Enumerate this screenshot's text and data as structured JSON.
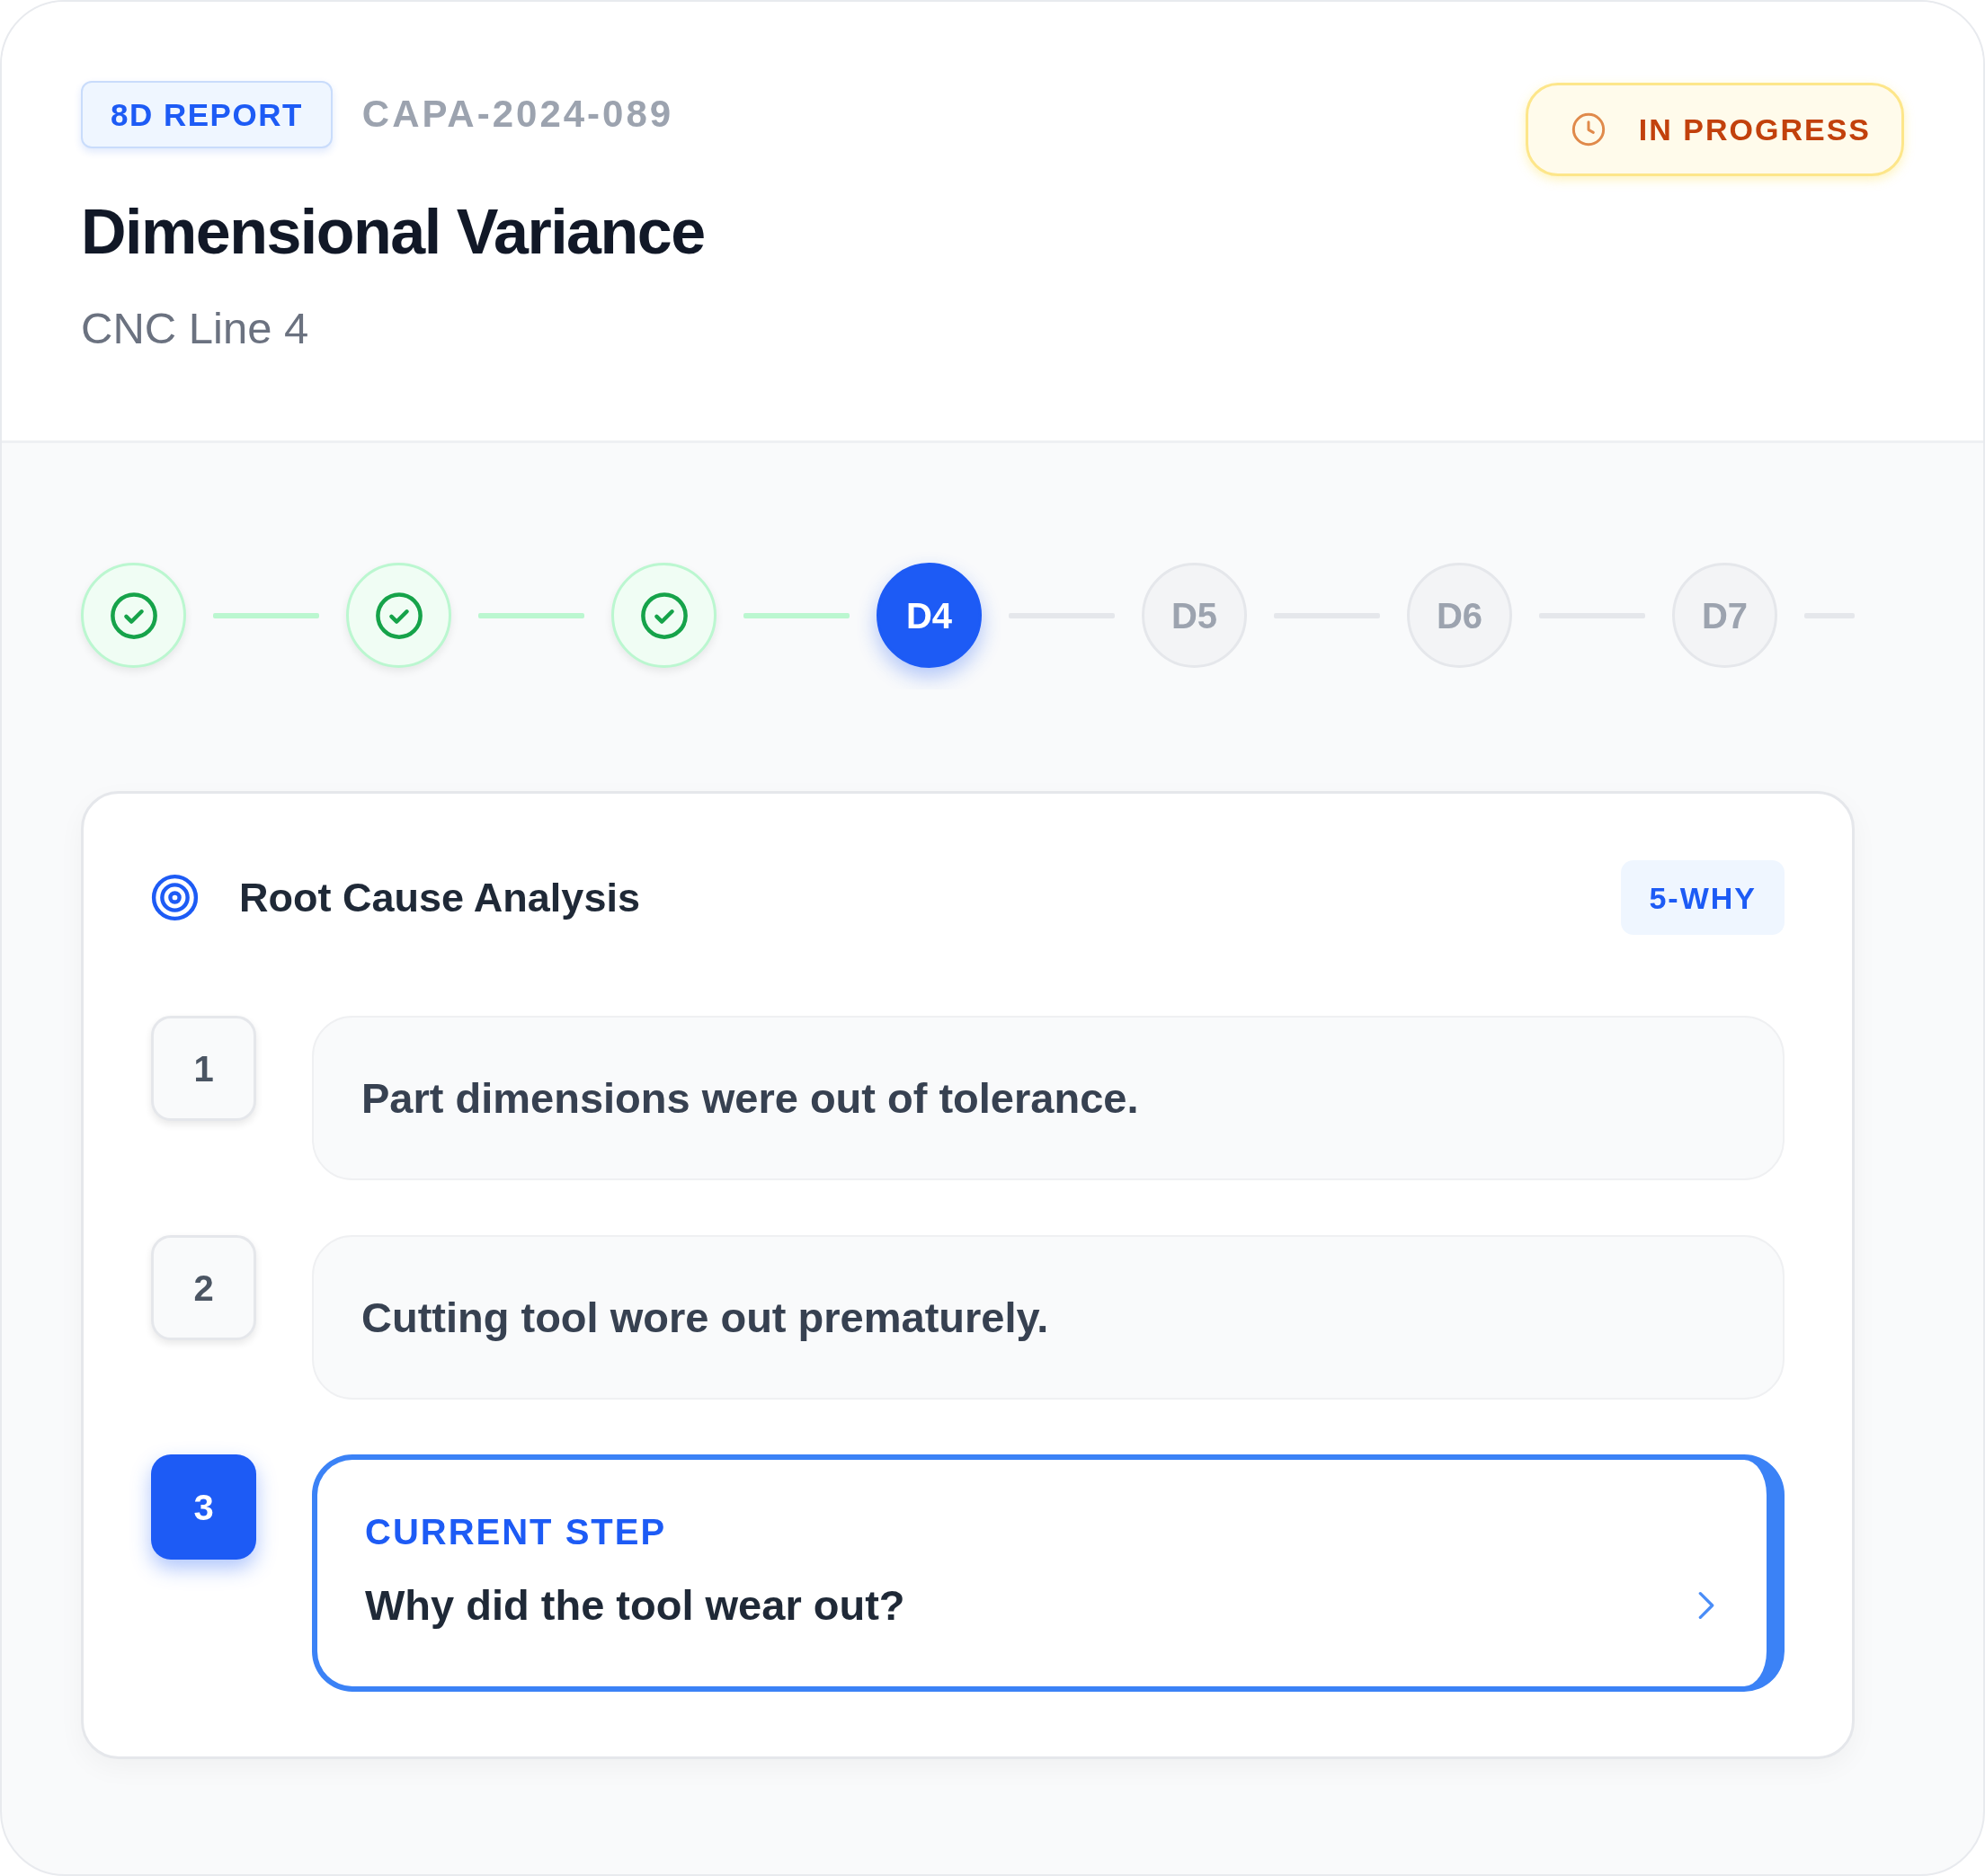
{
  "report": {
    "type_badge": "8D REPORT",
    "code": "CAPA-2024-089",
    "title": "Dimensional Variance",
    "subtitle": "CNC Line 4",
    "status": {
      "label": "IN PROGRESS",
      "kind": "in_progress"
    }
  },
  "steps": [
    {
      "completed": true,
      "selected": false
    },
    {
      "completed": true,
      "selected": false
    },
    {
      "completed": true,
      "selected": false
    },
    {
      "label": "D4",
      "completed": false,
      "selected": true
    },
    {
      "label": "D5",
      "completed": false,
      "selected": false
    },
    {
      "label": "D6",
      "completed": false,
      "selected": false
    },
    {
      "label": "D7",
      "completed": false,
      "selected": false
    }
  ],
  "analysis": {
    "title": "Root Cause Analysis",
    "method_badge": "5-WHY",
    "whys": [
      {
        "number": "1",
        "text": "Part dimensions were out of tolerance.",
        "current": false
      },
      {
        "number": "2",
        "text": "Cutting tool wore out prematurely.",
        "current": false
      },
      {
        "number": "3",
        "label": "CURRENT STEP",
        "text": "Why did the tool wear out?",
        "current": true
      }
    ]
  }
}
